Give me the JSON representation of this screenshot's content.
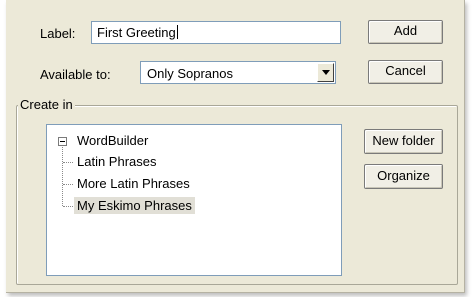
{
  "form": {
    "label_caption": "Label:",
    "label_value": "First Greeting",
    "available_caption": "Available to:",
    "available_value": "Only Sopranos"
  },
  "buttons": {
    "add": "Add",
    "cancel": "Cancel",
    "new_folder": "New folder",
    "organize": "Organize"
  },
  "create_in": {
    "title": "Create in",
    "root": "WordBuilder",
    "children": [
      "Latin Phrases",
      "More Latin Phrases",
      "My Eskimo Phrases"
    ],
    "selected": "My Eskimo Phrases"
  },
  "icons": {
    "dropdown": "chevron-down-icon",
    "collapse": "minus-box-icon"
  }
}
